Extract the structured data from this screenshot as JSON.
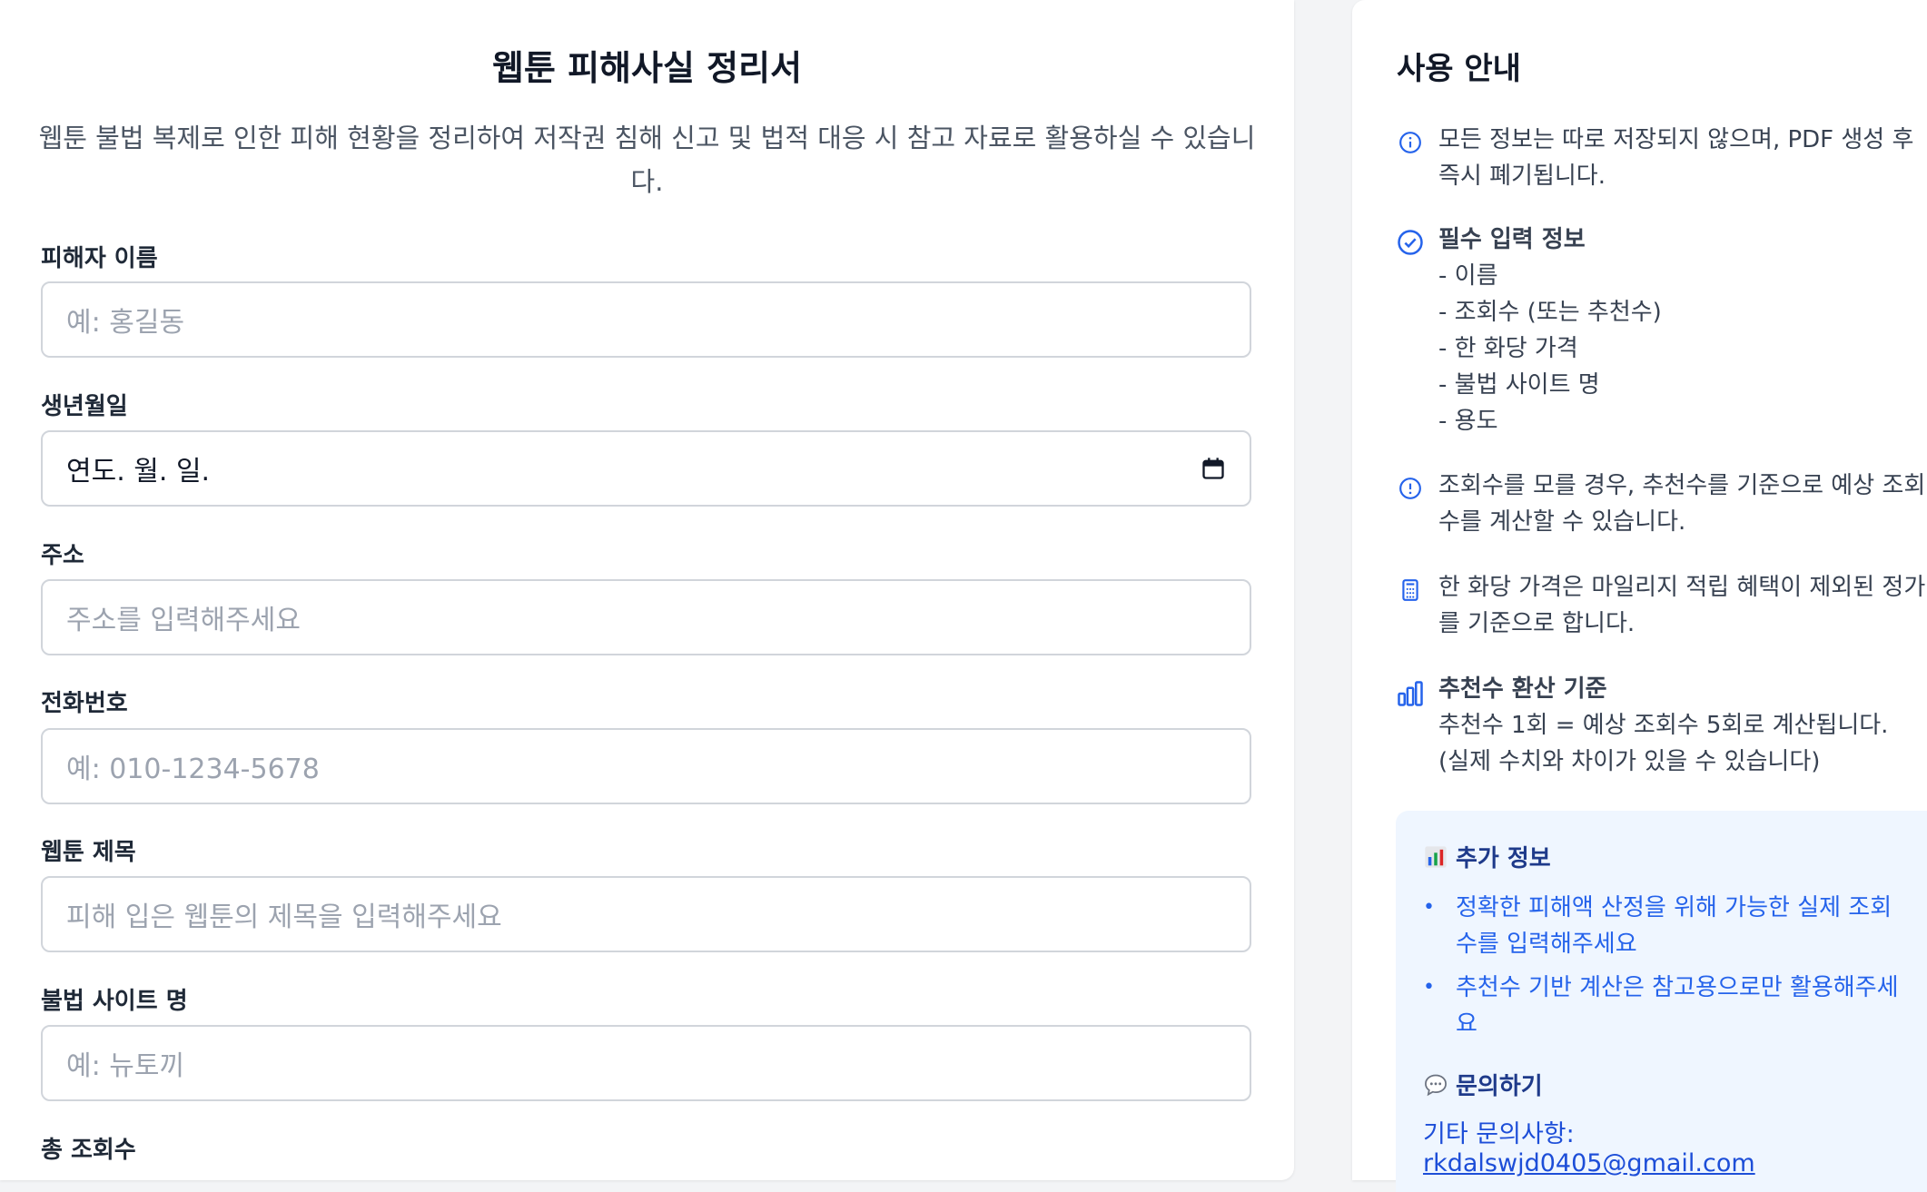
{
  "form": {
    "title": "웹툰 피해사실 정리서",
    "description": "웹툰 불법 복제로 인한 피해 현황을 정리하여 저작권 침해 신고 및 법적 대응 시 참고 자료로 활용하실 수 있습니다.",
    "fields": {
      "name": {
        "label": "피해자 이름",
        "placeholder": "예: 홍길동"
      },
      "birthdate": {
        "label": "생년월일",
        "value": "연도. 월. 일."
      },
      "address": {
        "label": "주소",
        "placeholder": "주소를 입력해주세요"
      },
      "phone": {
        "label": "전화번호",
        "placeholder": "예: 010-1234-5678"
      },
      "webtoon_title": {
        "label": "웹툰 제목",
        "placeholder": "피해 입은 웹툰의 제목을 입력해주세요"
      },
      "site_name": {
        "label": "불법 사이트 명",
        "placeholder": "예: 뉴토끼"
      },
      "total_views": {
        "label": "총 조회수"
      }
    }
  },
  "guide": {
    "title": "사용 안내",
    "privacy": "모든 정보는 따로 저장되지 않으며, PDF 생성 후 즉시 폐기됩니다.",
    "required": {
      "heading": "필수 입력 정보",
      "items": [
        "- 이름",
        "- 조회수 (또는 추천수)",
        "- 한 화당 가격",
        "- 불법 사이트 명",
        "- 용도"
      ]
    },
    "views_note": "조회수를 모를 경우, 추천수를 기준으로 예상 조회수를 계산할 수 있습니다.",
    "price_note": "한 화당 가격은 마일리지 적립 혜택이 제외된 정가를 기준으로 합니다.",
    "conversion": {
      "heading": "추천수 환산 기준",
      "line1": "추천수 1회 = 예상 조회수 5회로 계산됩니다.",
      "line2": "(실제 수치와 차이가 있을 수 있습니다)"
    }
  },
  "extra": {
    "heading": "추가 정보",
    "items": [
      "정확한 피해액 산정을 위해 가능한 실제 조회수를 입력해주세요",
      "추천수 기반 계산은 참고용으로만 활용해주세요"
    ],
    "contact_heading": "문의하기",
    "contact_prefix": "기타 문의사항: ",
    "contact_email": "rkdalswjd0405@gmail.com"
  },
  "colors": {
    "accent": "#2563eb",
    "info_bg": "#eff6ff",
    "page_bg": "#f3f4f6"
  },
  "icons": [
    "info-circle-icon",
    "check-circle-icon",
    "alert-circle-icon",
    "calculator-icon",
    "bar-chart-icon",
    "calendar-icon",
    "chart-emoji-icon",
    "speech-bubble-icon"
  ]
}
